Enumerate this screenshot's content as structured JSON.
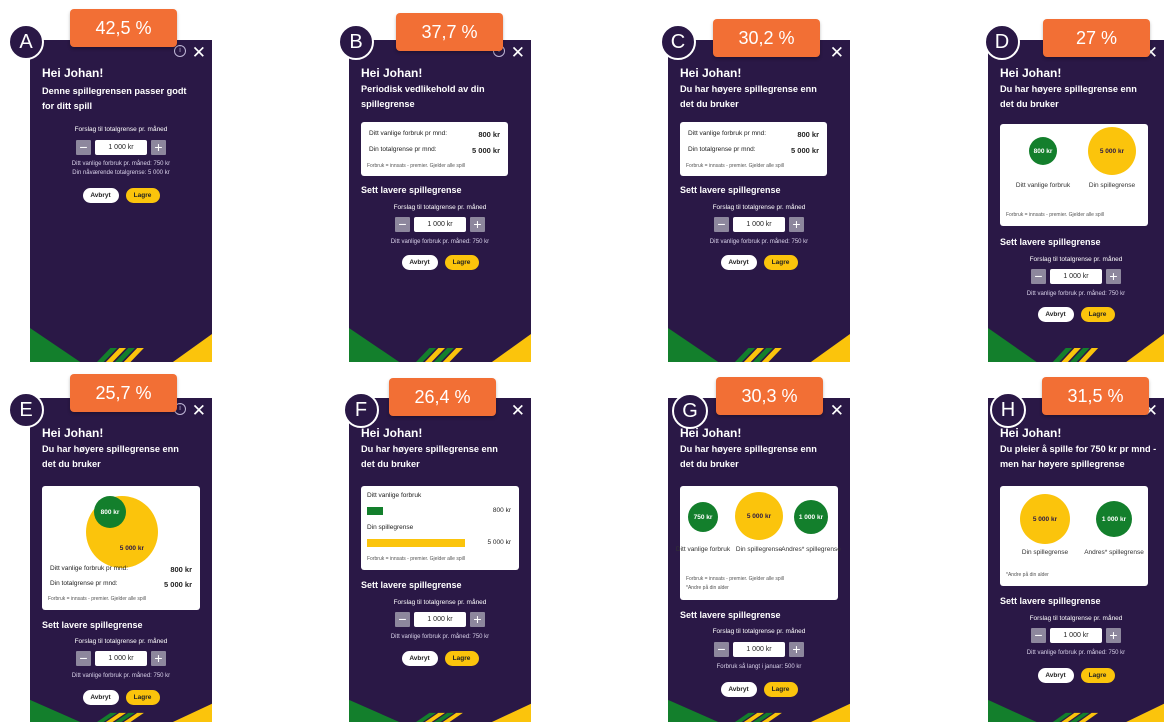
{
  "colors": {
    "background": "#2a1846",
    "accent_green": "#137f2c",
    "accent_yellow": "#fbc40c",
    "badge_orange": "#f26f35"
  },
  "icons": {
    "close": "close-icon",
    "info": "info-icon"
  },
  "variants": {
    "A": {
      "letter": "A",
      "percent": "42,5 %",
      "greeting": "Hei Johan!",
      "headline": "Denne spillegrensen passer godt for ditt spill",
      "suggest": "Forslag til totalgrense pr. måned",
      "value": "1 000 kr",
      "line1": "Ditt vanlige forbruk pr. måned: 750 kr",
      "line2": "Din nåværende totalgrense: 5 000 kr",
      "cancel": "Avbryt",
      "save": "Lagre"
    },
    "B": {
      "letter": "B",
      "percent": "37,7 %",
      "greeting": "Hei Johan!",
      "headline": "Periodisk vedlikehold av din spillegrense",
      "usage_label": "Ditt vanlige forbruk pr mnd:",
      "usage_value": "800 kr",
      "limit_label": "Din totalgrense pr mnd:",
      "limit_value": "5 000 kr",
      "note": "Forbruk = innsats - premier. Gjelder alle spill",
      "section": "Sett lavere spillegrense",
      "suggest": "Forslag til totalgrense pr. måned",
      "value": "1 000 kr",
      "hint": "Ditt vanlige forbruk pr. måned: 750 kr",
      "cancel": "Avbryt",
      "save": "Lagre"
    },
    "C": {
      "letter": "C",
      "percent": "30,2 %",
      "greeting": "Hei Johan!",
      "headline": "Du har høyere spillegrense enn det du bruker",
      "usage_label": "Ditt vanlige forbruk pr mnd:",
      "usage_value": "800 kr",
      "limit_label": "Din totalgrense pr mnd:",
      "limit_value": "5 000 kr",
      "note": "Forbruk = innsats - premier. Gjelder alle spill",
      "section": "Sett lavere spillegrense",
      "suggest": "Forslag til totalgrense pr. måned",
      "value": "1 000 kr",
      "hint": "Ditt vanlige forbruk pr. måned: 750 kr",
      "cancel": "Avbryt",
      "save": "Lagre"
    },
    "D": {
      "letter": "D",
      "percent": "27 %",
      "greeting": "Hei Johan!",
      "headline": "Du har høyere spillegrense enn det du bruker",
      "circle1": "800 kr",
      "circle1_label": "Ditt vanlige forbruk",
      "circle2": "5 000 kr",
      "circle2_label": "Din spillegrense",
      "note": "Forbruk = innsats - premier. Gjelder alle spill",
      "section": "Sett lavere spillegrense",
      "suggest": "Forslag til totalgrense pr. måned",
      "value": "1 000 kr",
      "hint": "Ditt vanlige forbruk pr. måned: 750 kr",
      "cancel": "Avbryt",
      "save": "Lagre"
    },
    "E": {
      "letter": "E",
      "percent": "25,7 %",
      "greeting": "Hei Johan!",
      "headline": "Du har høyere spillegrense enn det du bruker",
      "inner": "800 kr",
      "outer": "5 000 kr",
      "usage_label": "Ditt vanlige forbruk pr mnd:",
      "usage_value": "800 kr",
      "limit_label": "Din totalgrense pr mnd:",
      "limit_value": "5 000 kr",
      "note": "Forbruk = innsats - premier. Gjelder alle spill",
      "section": "Sett lavere spillegrense",
      "suggest": "Forslag til totalgrense pr. måned",
      "value": "1 000 kr",
      "hint": "Ditt vanlige forbruk pr. måned: 750 kr",
      "cancel": "Avbryt",
      "save": "Lagre"
    },
    "F": {
      "letter": "F",
      "percent": "26,4 %",
      "greeting": "Hei Johan!",
      "headline": "Du har høyere spillegrense enn det du bruker",
      "bar1_label": "Ditt vanlige forbruk",
      "bar1_value": "800 kr",
      "bar1_fraction": 0.16,
      "bar2_label": "Din spillegrense",
      "bar2_value": "5 000 kr",
      "bar2_fraction": 1.0,
      "note": "Forbruk = innsats - premier. Gjelder alle spill",
      "section": "Sett lavere spillegrense",
      "suggest": "Forslag til totalgrense pr. måned",
      "value": "1 000 kr",
      "hint": "Ditt vanlige forbruk pr. måned: 750 kr",
      "cancel": "Avbryt",
      "save": "Lagre"
    },
    "G": {
      "letter": "G",
      "percent": "30,3 %",
      "greeting": "Hei Johan!",
      "headline": "Du har høyere spillegrense enn det du bruker",
      "circle1": "750 kr",
      "circle1_label": "Ditt vanlige forbruk",
      "circle2": "5 000 kr",
      "circle2_label": "Din spillegrense",
      "circle3": "1 000 kr",
      "circle3_label": "Andres* spillegrense",
      "note": "Forbruk = innsats - premier. Gjelder alle spill",
      "note2": "*Andre på din alder",
      "section": "Sett lavere spillegrense",
      "suggest": "Forslag til totalgrense pr. måned",
      "value": "1 000 kr",
      "hint": "Forbruk så langt i januar: 500 kr",
      "cancel": "Avbryt",
      "save": "Lagre"
    },
    "H": {
      "letter": "H",
      "percent": "31,5 %",
      "greeting": "Hei Johan!",
      "headline": "Du pleier å spille for 750 kr pr mnd - men har høyere spillegrense",
      "circle1": "5 000 kr",
      "circle1_label": "Din spillegrense",
      "circle2": "1 000 kr",
      "circle2_label": "Andres* spillegrense",
      "note": "*Andre på din alder",
      "section": "Sett lavere spillegrense",
      "suggest": "Forslag til totalgrense pr. måned",
      "value": "1 000 kr",
      "hint": "Ditt vanlige forbruk pr. måned: 750 kr",
      "cancel": "Avbryt",
      "save": "Lagre"
    }
  }
}
